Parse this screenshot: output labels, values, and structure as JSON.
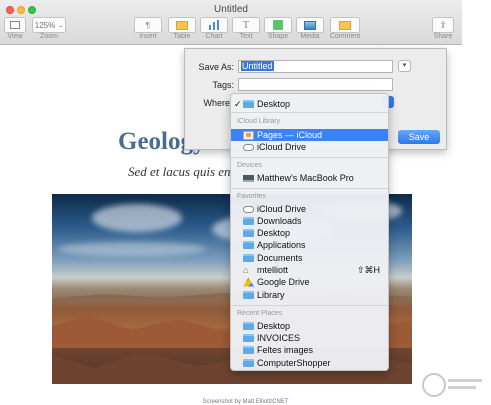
{
  "window": {
    "title": "Untitled"
  },
  "toolbar": {
    "view_label": "View",
    "zoom_value": "125%",
    "zoom_label": "Zoom",
    "insert_label": "Insert",
    "table_label": "Table",
    "chart_label": "Chart",
    "text_label": "Text",
    "shape_label": "Shape",
    "media_label": "Media",
    "comment_label": "Comment",
    "share_label": "Share",
    "text_icon_glyph": "T"
  },
  "save_dialog": {
    "save_as_label": "Save As:",
    "save_as_value": "Untitled",
    "tags_label": "Tags:",
    "tags_value": "",
    "where_label": "Where",
    "save_button": "Save"
  },
  "where_menu": {
    "current": {
      "label": "Desktop",
      "check": "✓",
      "icon": "folder-icon"
    },
    "sections": [
      {
        "header": "iCloud Library",
        "items": [
          {
            "label": "Pages — iCloud",
            "icon": "pages-icon",
            "highlighted": true
          },
          {
            "label": "iCloud Drive",
            "icon": "cloud-icon"
          }
        ]
      },
      {
        "header": "Devices",
        "items": [
          {
            "label": "Matthew's MacBook Pro",
            "icon": "laptop-icon"
          }
        ]
      },
      {
        "header": "Favorites",
        "items": [
          {
            "label": "iCloud Drive",
            "icon": "cloud-icon"
          },
          {
            "label": "Downloads",
            "icon": "folder-icon"
          },
          {
            "label": "Desktop",
            "icon": "folder-icon"
          },
          {
            "label": "Applications",
            "icon": "folder-icon"
          },
          {
            "label": "Documents",
            "icon": "folder-icon"
          },
          {
            "label": "mtelliott",
            "icon": "home-icon",
            "shortcut": "⇧⌘H"
          },
          {
            "label": "Google Drive",
            "icon": "google-drive-icon"
          },
          {
            "label": "Library",
            "icon": "folder-icon"
          }
        ]
      },
      {
        "header": "Recent Places",
        "items": [
          {
            "label": "Desktop",
            "icon": "folder-icon"
          },
          {
            "label": "INVOICES",
            "icon": "folder-icon"
          },
          {
            "label": "Feltes images",
            "icon": "folder-icon"
          },
          {
            "label": "ComputerShopper",
            "icon": "folder-icon"
          }
        ]
      }
    ]
  },
  "document": {
    "title": "Geology",
    "subtitle": "Sed et lacus quis en"
  },
  "caption": "Screenshot by Matt Elliott/CNET",
  "colors": {
    "accent": "#3c82f2",
    "title_blue": "#4a6e93"
  }
}
